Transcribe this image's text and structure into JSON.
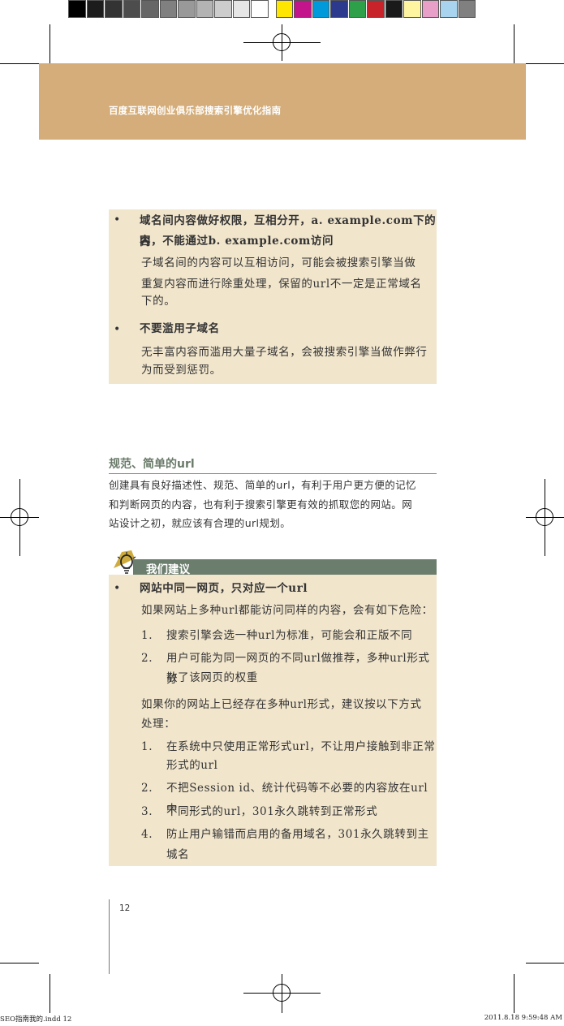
{
  "header": {
    "title": "百度互联网创业俱乐部搜索引擎优化指南"
  },
  "colors": {
    "header_bg": "#d4ad7a",
    "box_bg": "#f1e5cc",
    "suggest_bar": "#6b7d6d",
    "section_title": "#6a7b6a",
    "swatches": [
      "#000000",
      "#1c1c1c",
      "#333333",
      "#4d4d4d",
      "#666666",
      "#808080",
      "#999999",
      "#b3b3b3",
      "#cccccc",
      "#e6e6e6",
      "#ffffff",
      "#ffe600",
      "#c4148c",
      "#0099d9",
      "#2b3a8c",
      "#2ea04a",
      "#c8222a",
      "#1a1a1a",
      "#fff5a0",
      "#e8a0c8",
      "#a8d4ef",
      "#808080"
    ]
  },
  "box1": {
    "item1_title_a": "域名间内容做好权限，互相分开，a. example.com下的内",
    "item1_title_b": "容，不能通过b. example.com访问",
    "item1_body_a": "子域名间的内容可以互相访问，可能会被搜索引擎当做",
    "item1_body_b": "重复内容而进行除重处理，保留的url不一定是正常域名",
    "item1_body_c": "下的。",
    "item2_title": "不要滥用子域名",
    "item2_body_a": "无丰富内容而滥用大量子域名，会被搜索引擎当做作弊行",
    "item2_body_b": "为而受到惩罚。"
  },
  "section": {
    "title": "规范、简单的url",
    "intro_a": "创建具有良好描述性、规范、简单的url，有利于用户更方便的记忆",
    "intro_b": "和判断网页的内容，也有利于搜索引擎更有效的抓取您的网站。网",
    "intro_c": "站设计之初，就应该有合理的url规划。"
  },
  "suggest": {
    "label": "我们建议",
    "bullet_title": "网站中同一网页，只对应一个url",
    "risk_intro": "如果网站上多种url都能访问同样的内容，会有如下危险：",
    "risks": [
      {
        "num": "1.",
        "a": "搜索引擎会选一种url为标准，可能会和正版不同",
        "b": ""
      },
      {
        "num": "2.",
        "a": "用户可能为同一网页的不同url做推荐，多种url形式分",
        "b": "散了该网页的权重"
      }
    ],
    "fix_intro_a": "如果你的网站上已经存在多种url形式，建议按以下方式",
    "fix_intro_b": "处理：",
    "fixes": [
      {
        "num": "1.",
        "a": "在系统中只使用正常形式url，不让用户接触到非正常",
        "b": "形式的url"
      },
      {
        "num": "2.",
        "a": "不把Session id、统计代码等不必要的内容放在url中",
        "b": ""
      },
      {
        "num": "3.",
        "a": "不同形式的url，301永久跳转到正常形式",
        "b": ""
      },
      {
        "num": "4.",
        "a": "防止用户输错而启用的备用域名，301永久跳转到主",
        "b": "城名"
      }
    ]
  },
  "bullet_char": "•",
  "page_number": "12",
  "footer": {
    "left": "SEO指南我的.indd   12",
    "right": "2011.8.18   9:59:48 AM"
  }
}
